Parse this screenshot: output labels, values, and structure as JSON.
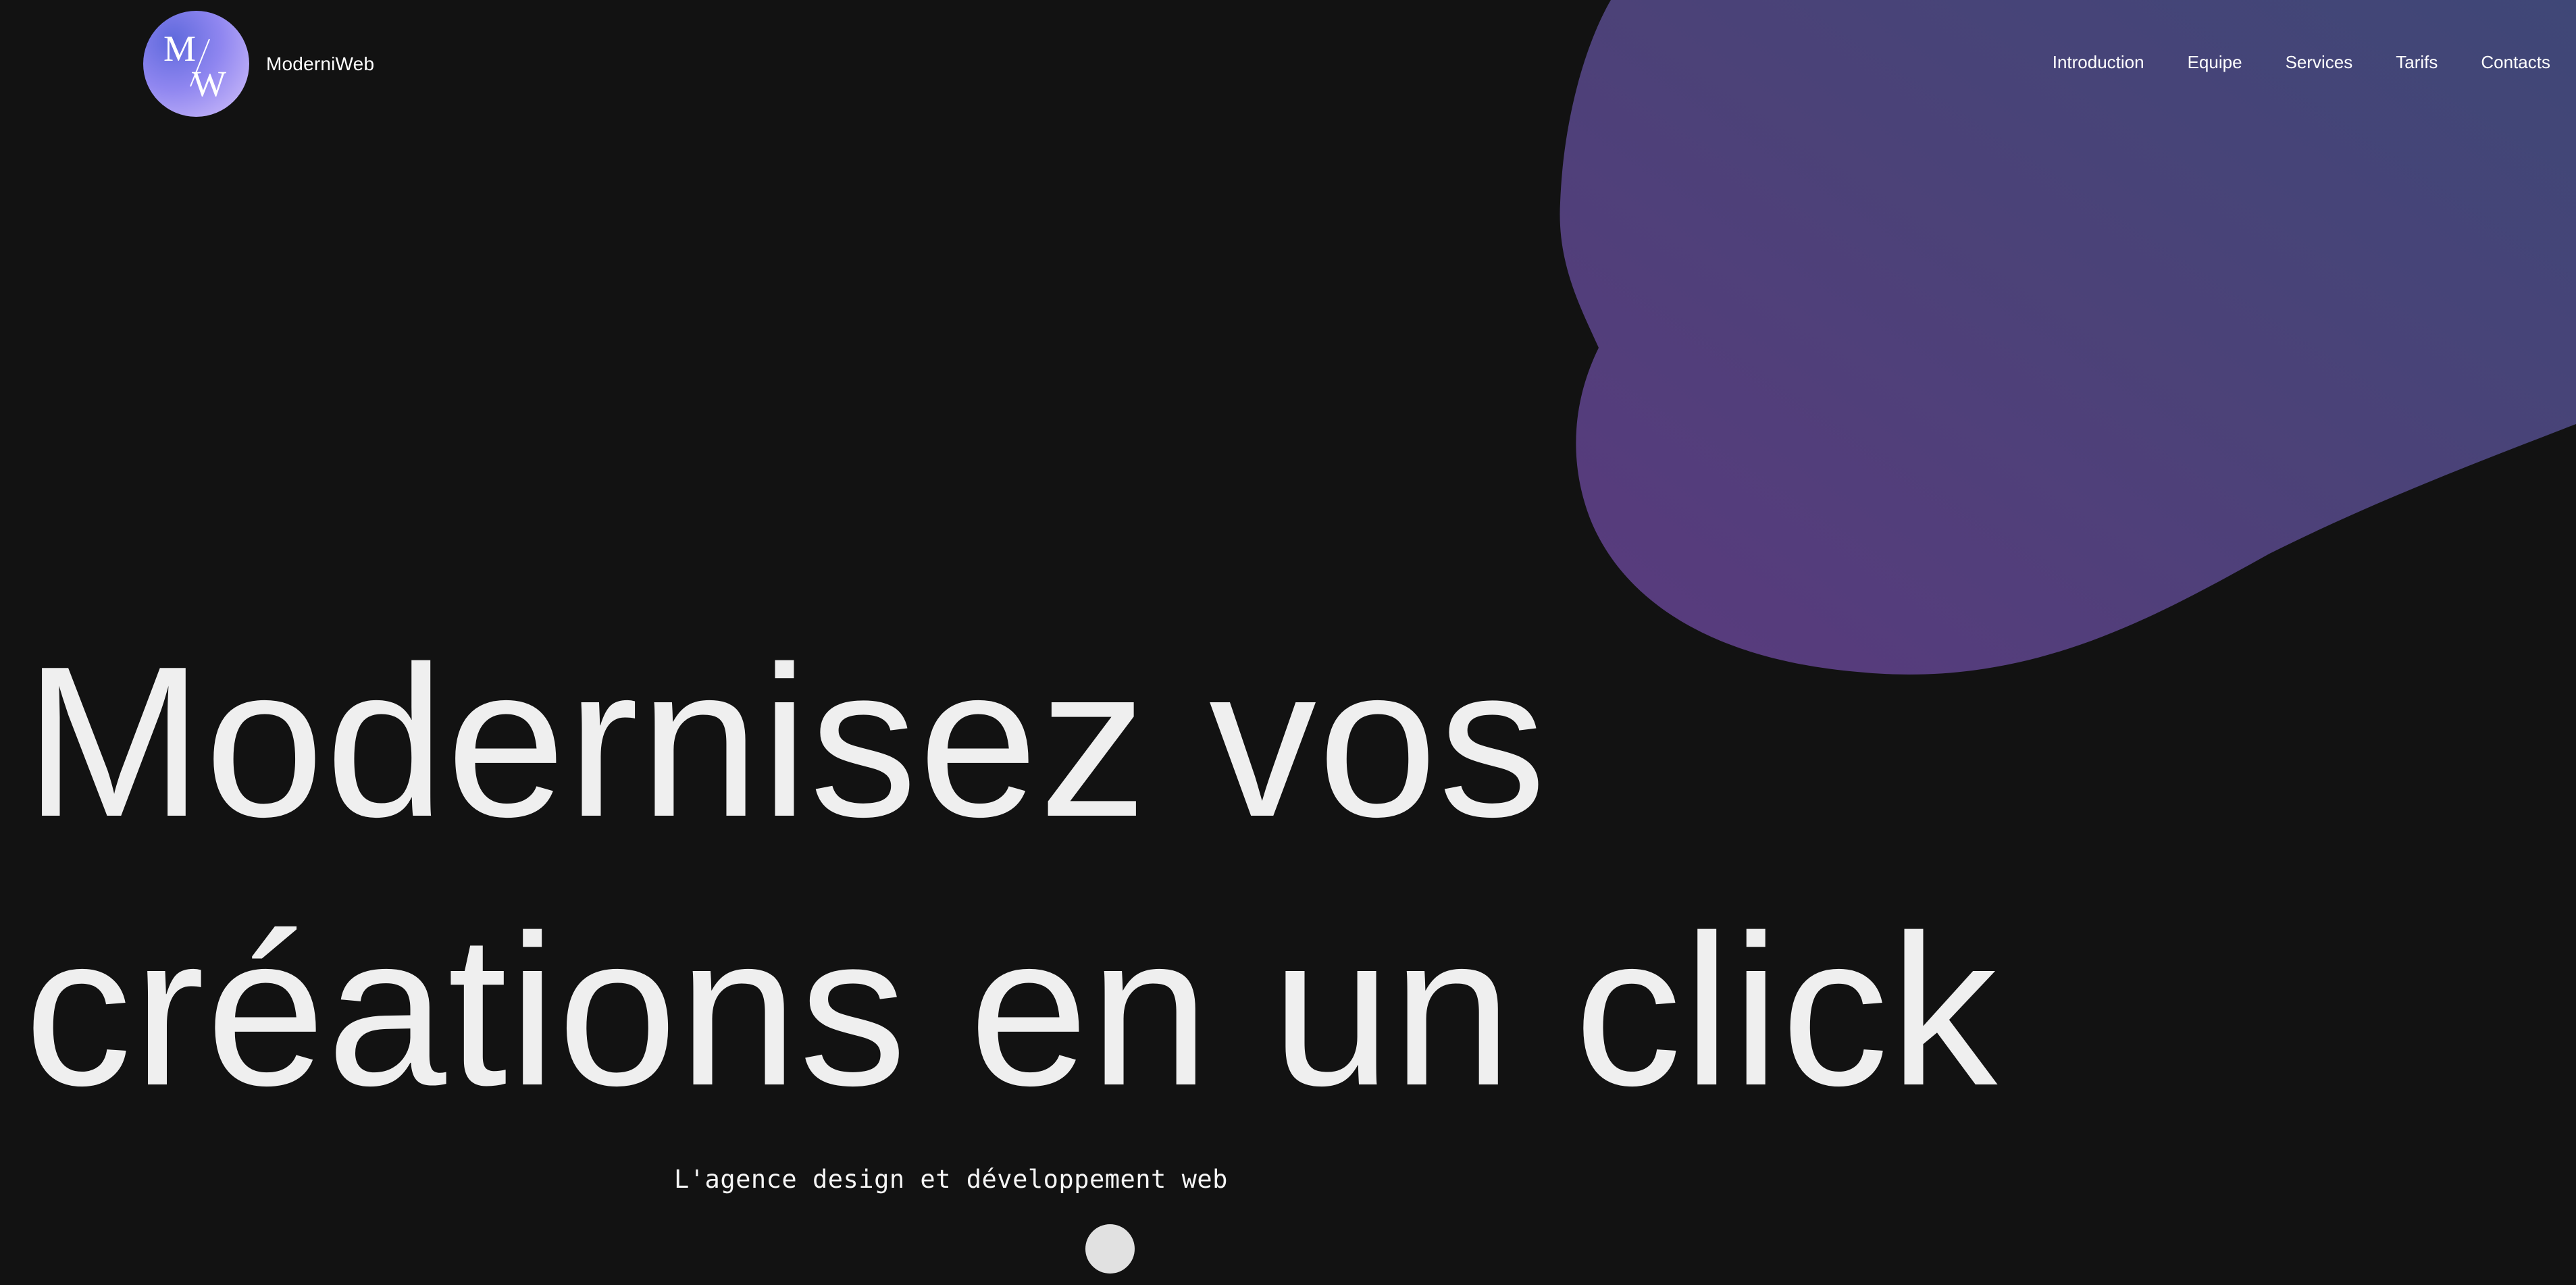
{
  "brand": {
    "logo_text": "MW",
    "name": "ModerniWeb"
  },
  "nav": {
    "items": [
      {
        "label": "Introduction"
      },
      {
        "label": "Equipe"
      },
      {
        "label": "Services"
      },
      {
        "label": "Tarifs"
      },
      {
        "label": "Contacts"
      }
    ]
  },
  "hero": {
    "title_line_1": "Modernisez vos",
    "title_line_2": "créations en un click",
    "subtitle": "L'agence design et développement web"
  },
  "colors": {
    "background": "#121212",
    "text": "#efefef",
    "blob_start": "#5a3a7e",
    "blob_end": "#3f4777",
    "logo_start": "#5f69dc",
    "logo_end": "#d4c2fb",
    "scroll_dot": "#e1e1e1"
  },
  "icons": {
    "scroll": "scroll-indicator-icon"
  }
}
